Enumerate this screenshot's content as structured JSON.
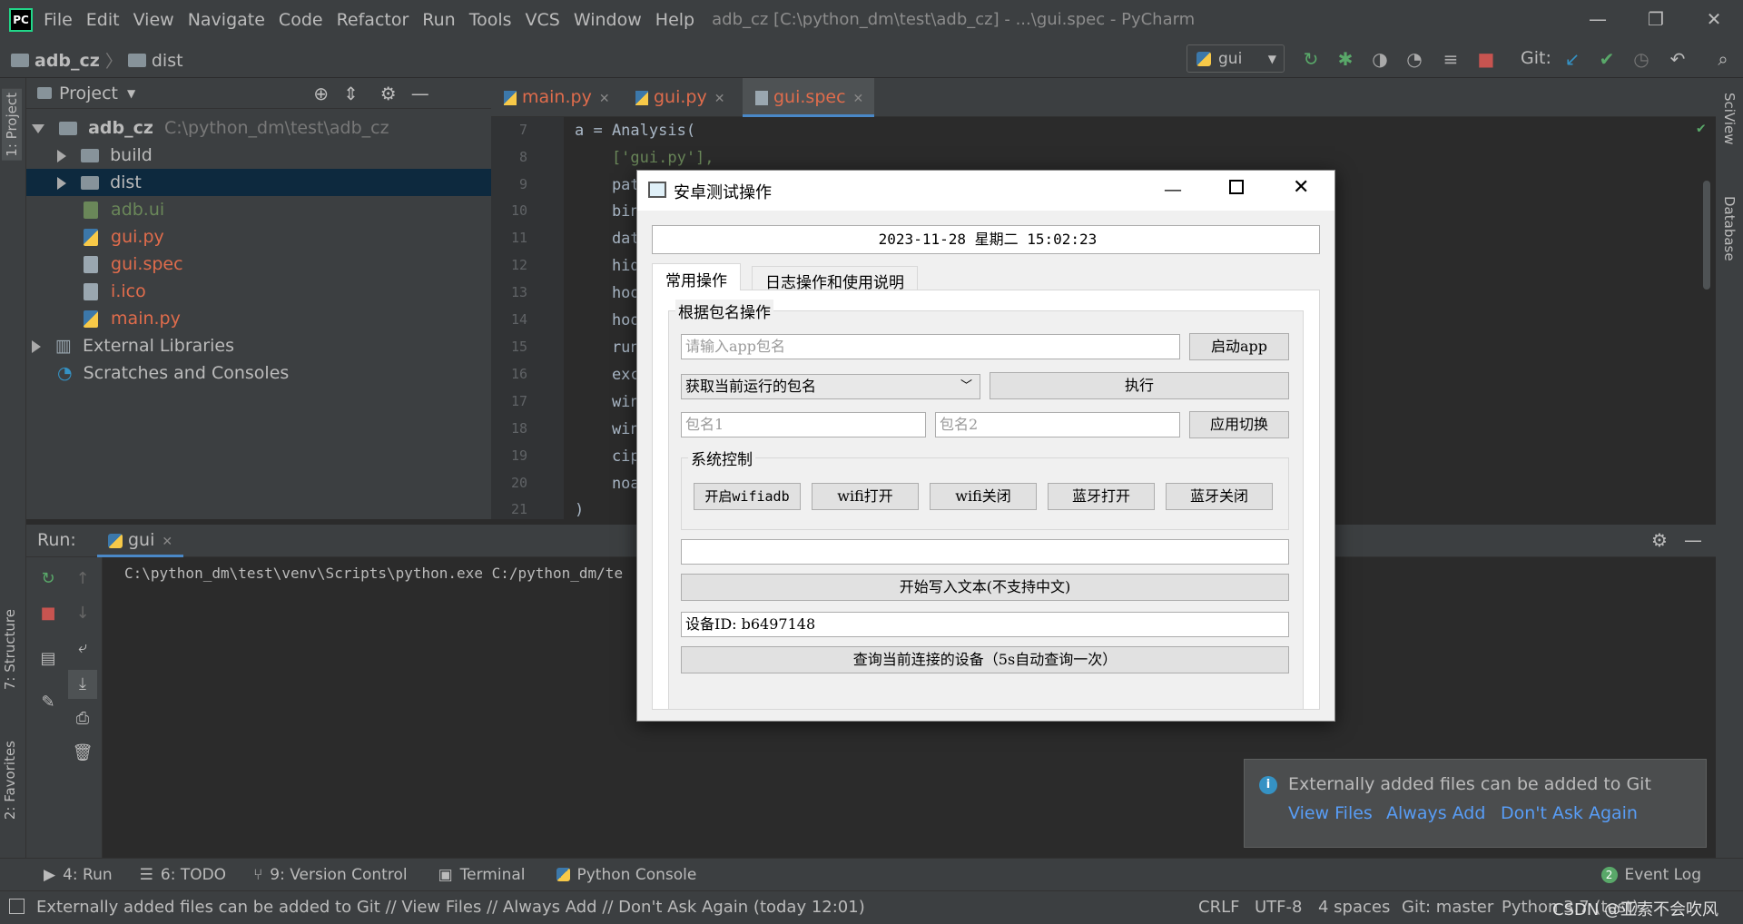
{
  "window": {
    "menu": [
      "File",
      "Edit",
      "View",
      "Navigate",
      "Code",
      "Refactor",
      "Run",
      "Tools",
      "VCS",
      "Window",
      "Help"
    ],
    "title": "adb_cz [C:\\python_dm\\test\\adb_cz] - ...\\gui.spec - PyCharm"
  },
  "nav": {
    "crumbs": [
      "adb_cz",
      "dist"
    ],
    "run_config": "gui",
    "git_label": "Git:"
  },
  "left_tabs": [
    "1: Project",
    "7: Structure",
    "2: Favorites"
  ],
  "right_tabs": [
    "SciView",
    "Database"
  ],
  "project": {
    "header": "Project",
    "tree": [
      {
        "label": "adb_cz",
        "extra": "C:\\python_dm\\test\\adb_cz",
        "type": "root"
      },
      {
        "label": "build",
        "type": "folder"
      },
      {
        "label": "dist",
        "type": "folder"
      },
      {
        "label": "adb.ui",
        "type": "file",
        "color": "#6a8759"
      },
      {
        "label": "gui.py",
        "type": "file",
        "color": "#e06c4c"
      },
      {
        "label": "gui.spec",
        "type": "file",
        "color": "#e06c4c"
      },
      {
        "label": "i.ico",
        "type": "file",
        "color": "#e06c4c"
      },
      {
        "label": "main.py",
        "type": "file",
        "color": "#e06c4c"
      },
      {
        "label": "External Libraries",
        "type": "lib"
      },
      {
        "label": "Scratches and Consoles",
        "type": "scratch"
      }
    ]
  },
  "editor": {
    "tabs": [
      "main.py",
      "gui.py",
      "gui.spec"
    ],
    "line_numbers": [
      "7",
      "8",
      "9",
      "10",
      "11",
      "12",
      "13",
      "14",
      "15",
      "16",
      "17",
      "18",
      "19",
      "20",
      "21"
    ],
    "lines": [
      "a = Analysis(",
      "    ['gui.py'],",
      "    pat",
      "    bin",
      "    dat",
      "    hid",
      "    hoo",
      "    hoo",
      "    run",
      "    exc",
      "    win",
      "    win",
      "    cip",
      "    noa",
      ")"
    ]
  },
  "run": {
    "label": "Run:",
    "tab": "gui",
    "output": "C:\\python_dm\\test\\venv\\Scripts\\python.exe C:/python_dm/te"
  },
  "bottom_tabs": [
    "4: Run",
    "6: TODO",
    "9: Version Control",
    "Terminal",
    "Python Console"
  ],
  "event_log": {
    "label": "Event Log",
    "count": "2"
  },
  "status": {
    "message": "Externally added files can be added to Git // View Files // Always Add // Don't Ask Again (today 12:01)",
    "items": [
      "CRLF",
      "UTF-8",
      "4 spaces",
      "Git: master",
      "Python 3.7 (test)"
    ],
    "watermark": "CSDN @亚索不会吹风"
  },
  "notification": {
    "text": "Externally added files can be added to Git",
    "actions": [
      "View Files",
      "Always Add",
      "Don't Ask Again"
    ]
  },
  "dialog": {
    "title": "安卓测试操作",
    "datetime": "2023-11-28 星期二 15:02:23",
    "tabs": [
      "常用操作",
      "日志操作和使用说明"
    ],
    "group_pkg": "根据包名操作",
    "pkg_placeholder": "请输入app包名",
    "btn_start": "启动app",
    "select_value": "获取当前运行的包名",
    "btn_exec": "执行",
    "pkg1_placeholder": "包名1",
    "pkg2_placeholder": "包名2",
    "btn_switch": "应用切换",
    "group_sys": "系统控制",
    "sys_buttons": [
      "开启wifiadb",
      "wifi打开",
      "wifi关闭",
      "蓝牙打开",
      "蓝牙关闭"
    ],
    "text_input": "",
    "btn_write": "开始写入文本(不支持中文)",
    "device_id": "设备ID: b6497148",
    "btn_query": "查询当前连接的设备（5s自动查询一次）"
  }
}
